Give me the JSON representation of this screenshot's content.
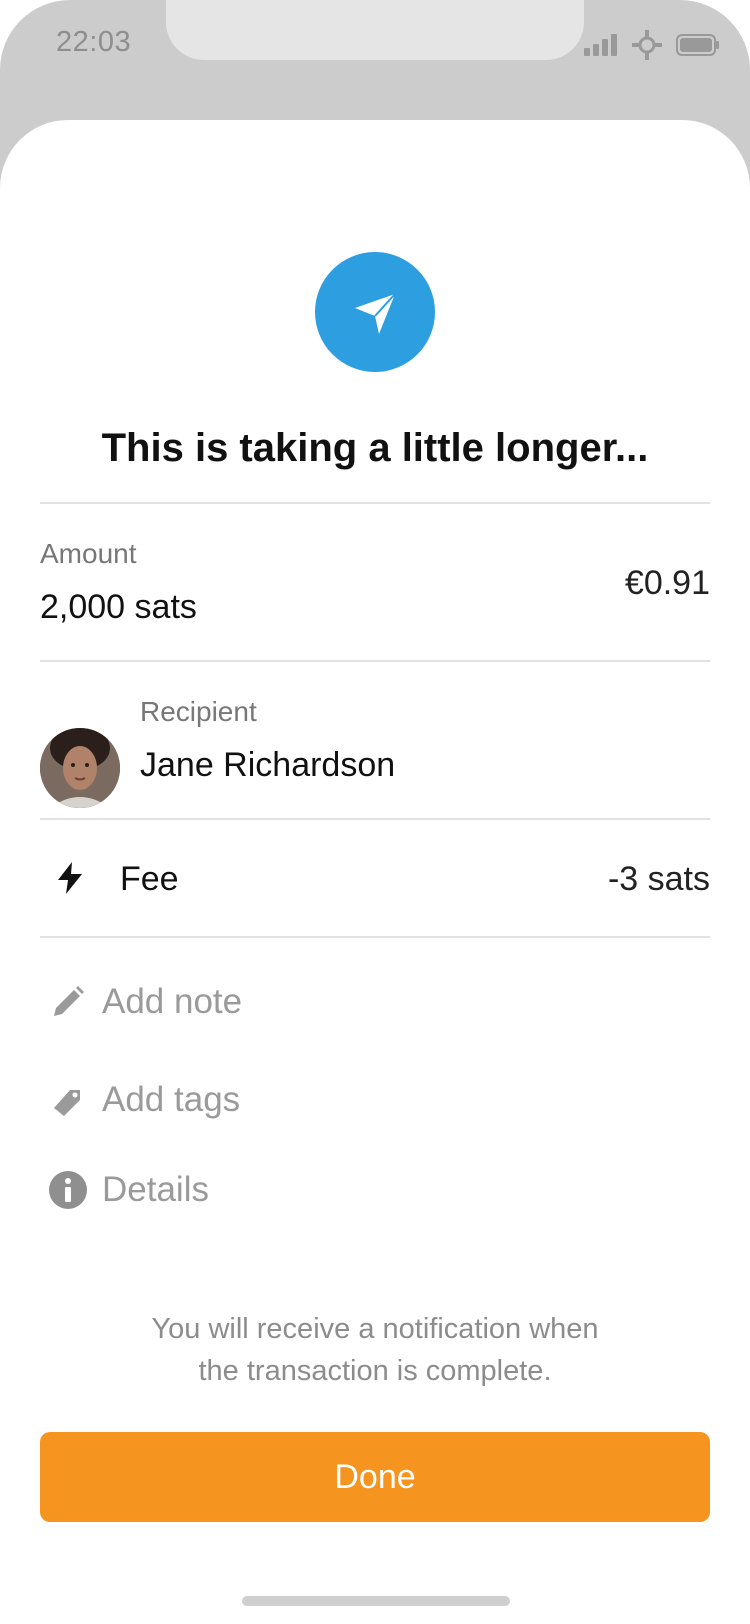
{
  "status_bar": {
    "time": "22:03"
  },
  "header": {
    "title": "This is taking a little longer..."
  },
  "amount": {
    "label": "Amount",
    "value": "2,000 sats",
    "fiat": "€0.91"
  },
  "recipient": {
    "label": "Recipient",
    "name": "Jane Richardson"
  },
  "fee": {
    "label": "Fee",
    "value": "-3 sats"
  },
  "actions": {
    "add_note": "Add note",
    "add_tags": "Add tags",
    "details": "Details"
  },
  "notice": {
    "line1": "You will receive a notification when",
    "line2": "the transaction is complete."
  },
  "done_button": {
    "label": "Done"
  },
  "icons": {
    "hero": "send-paper-plane-icon",
    "fee": "lightning-bolt-icon",
    "note": "pencil-icon",
    "tags": "tag-icon",
    "details": "info-icon"
  },
  "colors": {
    "accent_blue": "#2d9ee0",
    "primary_orange": "#f5941e",
    "backdrop_gray": "#cccccc"
  }
}
